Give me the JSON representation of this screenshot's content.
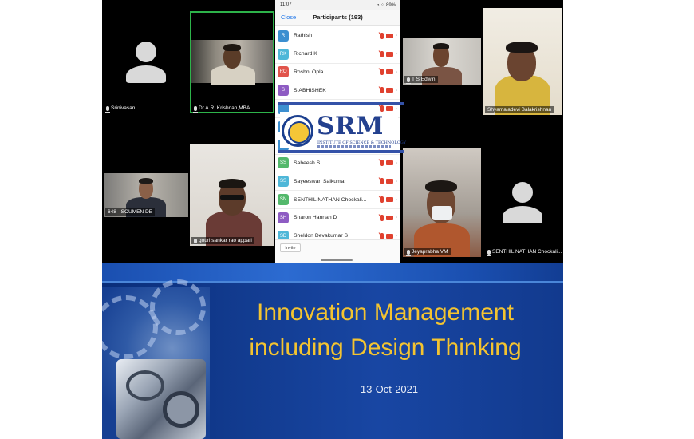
{
  "phone": {
    "status_time": "11:07",
    "status_icons": "◔ ⁘ 89%",
    "close_label": "Close",
    "title": "Participants (193)",
    "invite_label": "Invite",
    "participants": [
      {
        "initials": "R",
        "name": "Rathish",
        "color": "#3c8fd0"
      },
      {
        "initials": "RK",
        "name": "Richard K",
        "color": "#4fb7d8"
      },
      {
        "initials": "RO",
        "name": "Roshni Opla",
        "color": "#e1544b"
      },
      {
        "initials": "S",
        "name": "S.ABHISHEK",
        "color": "#8e5cc3"
      },
      {
        "initials": "",
        "name": "",
        "color": "#3c8fd0"
      },
      {
        "initials": "",
        "name": "",
        "color": "#3c8fd0"
      },
      {
        "initials": "",
        "name": "",
        "color": "#3c8fd0"
      },
      {
        "initials": "SS",
        "name": "Sabeesh S",
        "color": "#53b86b"
      },
      {
        "initials": "SS",
        "name": "Sayeeswari Saikumar",
        "color": "#4fb7d8"
      },
      {
        "initials": "SN",
        "name": "SENTHIL NATHAN Chockali...",
        "color": "#53b86b"
      },
      {
        "initials": "SH",
        "name": "Sharon Hannah D",
        "color": "#8e5cc3"
      },
      {
        "initials": "SD",
        "name": "Sheldon Devakumar S",
        "color": "#4fb7d8"
      }
    ]
  },
  "tiles": {
    "srinivasan": "Srinivasan",
    "krishnan": "Dr.A.R. Krishnan,MBA .",
    "soumen": "648 - SOUMEN DE",
    "gouri": "gouri sankar rao appari",
    "edwin": "T S Edwin",
    "shyamala": "Shyamaladevi Balakrishnan",
    "jeyaprabha": "Jeyaprabha VM",
    "senthil": "SENTHIL NATHAN Chockali..."
  },
  "logo": {
    "text": "SRM",
    "subtitle": "INSTITUTE OF SCIENCE & TECHNOLOGY"
  },
  "slide": {
    "title_line1": "Innovation Management",
    "title_line2": "including Design Thinking",
    "date": "13-Oct-2021"
  },
  "colors": {
    "active_speaker": "#2db34a",
    "slide_title": "#f4c430",
    "slide_bg": "#123b8f",
    "logo_blue": "#23408e"
  }
}
